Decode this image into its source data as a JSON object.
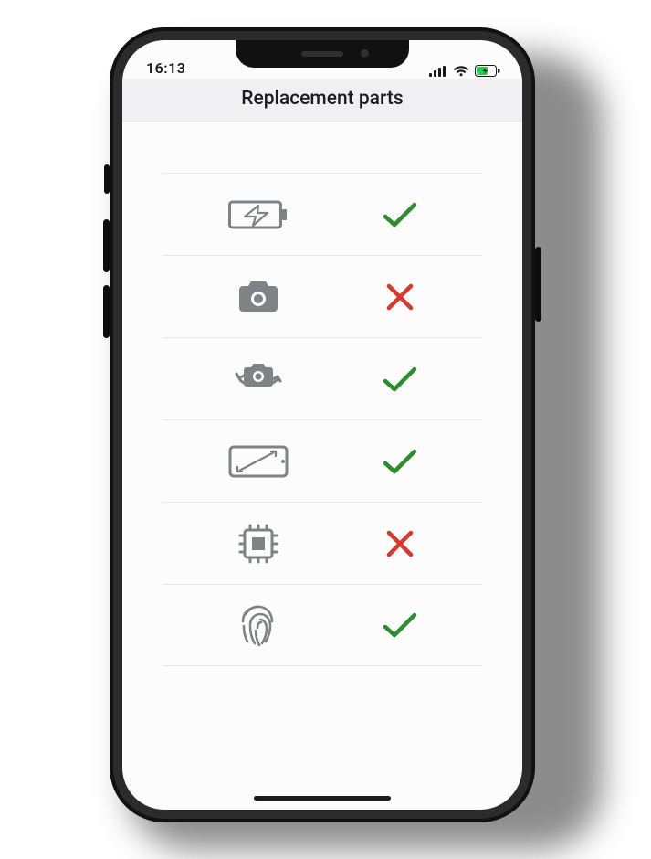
{
  "status_bar": {
    "time": "16:13"
  },
  "header": {
    "title": "Replacement parts"
  },
  "parts": [
    {
      "part": "battery",
      "icon": "battery-charging-icon",
      "status": "ok"
    },
    {
      "part": "camera",
      "icon": "camera-icon",
      "status": "bad"
    },
    {
      "part": "camera_flip",
      "icon": "camera-rotate-icon",
      "status": "ok"
    },
    {
      "part": "display",
      "icon": "display-size-icon",
      "status": "ok"
    },
    {
      "part": "chip",
      "icon": "cpu-chip-icon",
      "status": "bad"
    },
    {
      "part": "fingerprint",
      "icon": "fingerprint-icon",
      "status": "ok"
    }
  ],
  "colors": {
    "ok": "#2e8b2e",
    "bad": "#d23b2e",
    "icon": "#808286"
  }
}
